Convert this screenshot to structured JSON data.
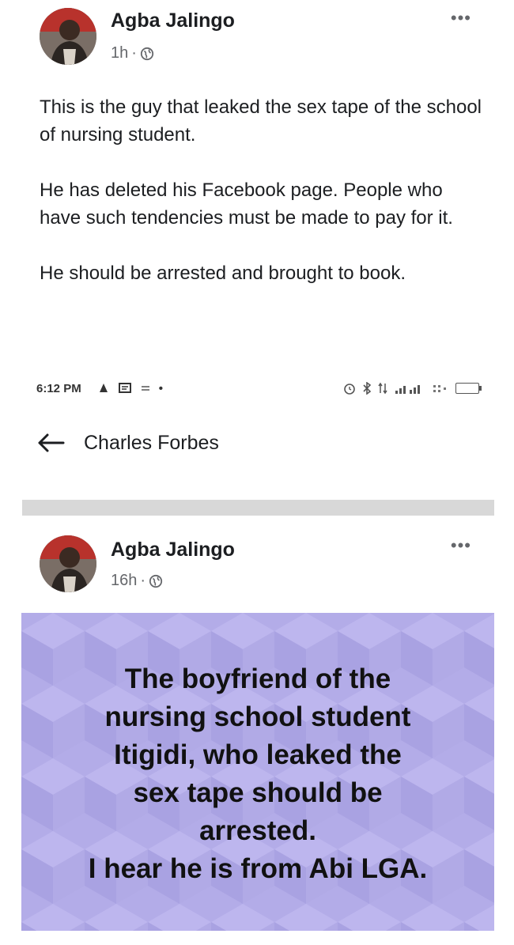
{
  "posts": [
    {
      "author": "Agba Jalingo",
      "time": "1h",
      "separator": "·",
      "more": "•••",
      "paragraphs": [
        "This is the guy that leaked the sex tape of the school of nursing student.",
        "He has deleted his Facebook page. People who have such tendencies must be made to pay for it.",
        "He should be arrested and brought to book."
      ]
    },
    {
      "author": "Agba Jalingo",
      "time": "16h",
      "separator": "·",
      "more": "•••",
      "card_lines": [
        "The boyfriend of the",
        "nursing school student",
        "Itigidi, who leaked the",
        "sex tape should be",
        "arrested.",
        "I hear he is from Abi LGA."
      ],
      "card_color": "#b3ace8"
    }
  ],
  "statusbar": {
    "time": "6:12 PM",
    "dot": "•",
    "icons_left": [
      "notification-icon",
      "message-icon",
      "equals-icon"
    ],
    "icons_right": [
      "alarm-icon",
      "bluetooth-icon",
      "data-arrows-icon",
      "signal-icon",
      "wifi-icon",
      "battery-icon"
    ]
  },
  "navbar": {
    "title": "Charles Forbes"
  }
}
